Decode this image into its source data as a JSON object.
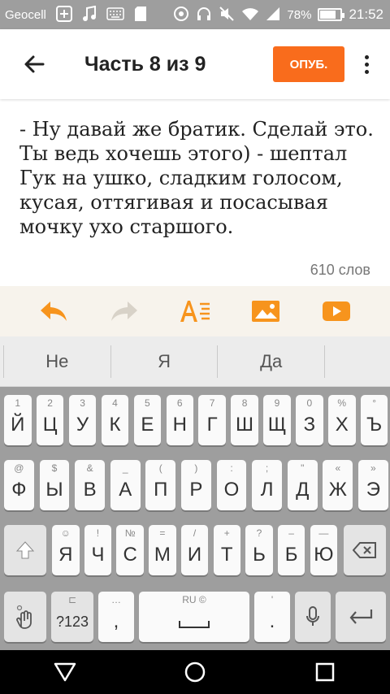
{
  "status_bar": {
    "carrier": "Geocell",
    "battery_percent": "78%",
    "battery_level": 0.78,
    "time": "21:52",
    "icons": [
      "add-icon",
      "music-icon",
      "keyboard-icon",
      "sd-card-icon",
      "alarm-icon",
      "headset-icon",
      "mute-icon",
      "wifi-icon",
      "signal-icon",
      "battery-icon"
    ]
  },
  "app_bar": {
    "title": "Часть 8 из 9",
    "publish_label": "ОПУБ.",
    "accent": "#f96c1c"
  },
  "editor": {
    "text": "- Ну давай же братик. Сделай это. Ты ведь хочешь этого) - шептал Гук на ушко, сладким голосом, кусая, оттягивая и посасывая мочку ухо старшого.",
    "word_count": "610 слов"
  },
  "format_toolbar": {
    "items": [
      "undo-icon",
      "redo-icon",
      "text-format-icon",
      "image-icon",
      "video-icon"
    ]
  },
  "keyboard": {
    "suggestions": [
      "Не",
      "Я",
      "Да"
    ],
    "row1": [
      {
        "hint": "1",
        "label": "Й"
      },
      {
        "hint": "2",
        "label": "Ц"
      },
      {
        "hint": "3",
        "label": "У"
      },
      {
        "hint": "4",
        "label": "К"
      },
      {
        "hint": "5",
        "label": "Е"
      },
      {
        "hint": "6",
        "label": "Н"
      },
      {
        "hint": "7",
        "label": "Г"
      },
      {
        "hint": "8",
        "label": "Ш"
      },
      {
        "hint": "9",
        "label": "Щ"
      },
      {
        "hint": "0",
        "label": "З"
      },
      {
        "hint": "%",
        "label": "Х"
      },
      {
        "hint": "°",
        "label": "Ъ"
      }
    ],
    "row2": [
      {
        "hint": "@",
        "label": "Ф"
      },
      {
        "hint": "$",
        "label": "Ы"
      },
      {
        "hint": "&",
        "label": "В"
      },
      {
        "hint": "_",
        "label": "А"
      },
      {
        "hint": "(",
        "label": "П"
      },
      {
        "hint": ")",
        "label": "Р"
      },
      {
        "hint": ":",
        "label": "О"
      },
      {
        "hint": ";",
        "label": "Л"
      },
      {
        "hint": "\"",
        "label": "Д"
      },
      {
        "hint": "«",
        "label": "Ж"
      },
      {
        "hint": "»",
        "label": "Э"
      }
    ],
    "row3": [
      {
        "hint": "☺",
        "label": "Я"
      },
      {
        "hint": "!",
        "label": "Ч"
      },
      {
        "hint": "№",
        "label": "С"
      },
      {
        "hint": "=",
        "label": "М"
      },
      {
        "hint": "/",
        "label": "И"
      },
      {
        "hint": "+",
        "label": "Т"
      },
      {
        "hint": "?",
        "label": "Ь"
      },
      {
        "hint": "–",
        "label": "Б"
      },
      {
        "hint": "—",
        "label": "Ю"
      }
    ],
    "row4": {
      "numbers_label": "?123",
      "comma_hint": "…",
      "comma_label": ",",
      "space_hint": "RU ©",
      "period_hint": "'",
      "period_label": "."
    }
  },
  "nav_bar": {
    "items": [
      "back-triangle-icon",
      "home-circle-icon",
      "recents-square-icon"
    ]
  }
}
